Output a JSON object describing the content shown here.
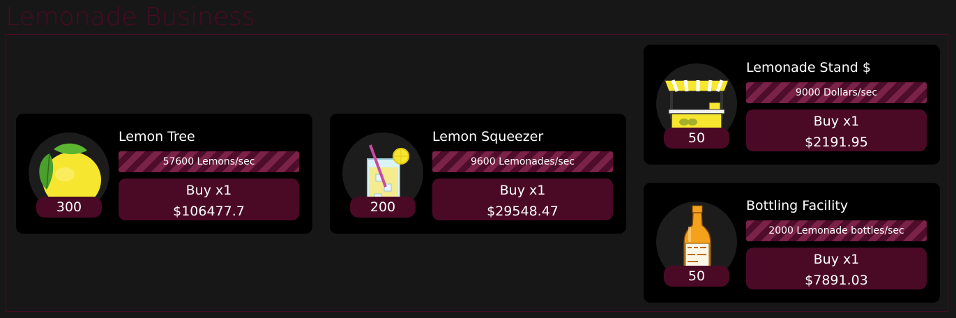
{
  "page": {
    "title": "Lemonade Business"
  },
  "colors": {
    "background": "#171717",
    "card": "#000000",
    "accent": "#4a0a25",
    "stripe_light": "#7a2248",
    "stripe_dark": "#4d0d2b"
  },
  "items": [
    {
      "name": "Lemon Tree",
      "icon": "lemon-icon",
      "count": "300",
      "rate": "57600 Lemons/sec",
      "buy_label": "Buy x1",
      "price": "$106477.7"
    },
    {
      "name": "Lemon Squeezer",
      "icon": "lemonade-glass-icon",
      "count": "200",
      "rate": "9600 Lemonades/sec",
      "buy_label": "Buy x1",
      "price": "$29548.47"
    },
    {
      "name": "Lemonade Stand $",
      "icon": "lemonade-stand-icon",
      "count": "50",
      "rate": "9000 Dollars/sec",
      "buy_label": "Buy x1",
      "price": "$2191.95"
    },
    {
      "name": "Bottling Facility",
      "icon": "lemonade-bottle-icon",
      "count": "50",
      "rate": "2000 Lemonade bottles/sec",
      "buy_label": "Buy x1",
      "price": "$7891.03"
    }
  ]
}
